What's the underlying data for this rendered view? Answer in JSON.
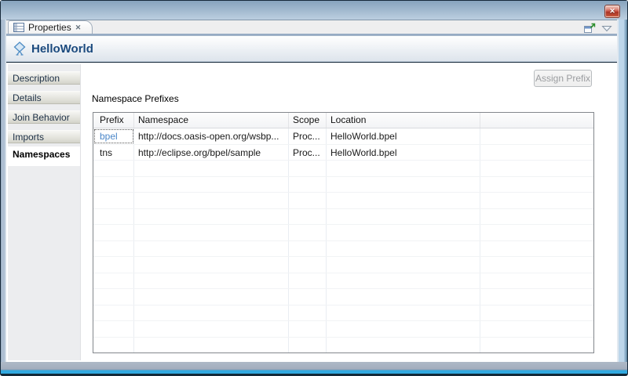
{
  "window": {
    "close_glyph": "✕"
  },
  "tabbar": {
    "tab_label": "Properties",
    "tab_close_glyph": "✕"
  },
  "header": {
    "title": "HelloWorld"
  },
  "sidebar": {
    "items": [
      {
        "label": "Description",
        "selected": false
      },
      {
        "label": "Details",
        "selected": false
      },
      {
        "label": "Join Behavior",
        "selected": false
      },
      {
        "label": "Imports",
        "selected": false
      },
      {
        "label": "Namespaces",
        "selected": true
      }
    ]
  },
  "main": {
    "assign_button_label": "Assign Prefix",
    "assign_button_enabled": false,
    "section_label": "Namespace Prefixes",
    "table": {
      "columns": [
        "Prefix",
        "Namespace",
        "Scope",
        "Location",
        ""
      ],
      "rows": [
        {
          "prefix": "bpel",
          "namespace": "http://docs.oasis-open.org/wsbp...",
          "scope": "Proc...",
          "location": "HelloWorld.bpel",
          "prefix_is_link": true,
          "focused": true
        },
        {
          "prefix": "tns",
          "namespace": "http://eclipse.org/bpel/sample",
          "scope": "Proc...",
          "location": "HelloWorld.bpel",
          "prefix_is_link": false,
          "focused": false
        }
      ],
      "empty_row_count": 12
    }
  },
  "colors": {
    "link_blue": "#4a86c8",
    "title_blue": "#1b4a7e",
    "frame_blue": "#aec3d8",
    "close_red": "#c24e3f",
    "cyan_accent": "#2fa8df",
    "table_border": "#83878c",
    "sidebar_bg": "#ecedef"
  }
}
